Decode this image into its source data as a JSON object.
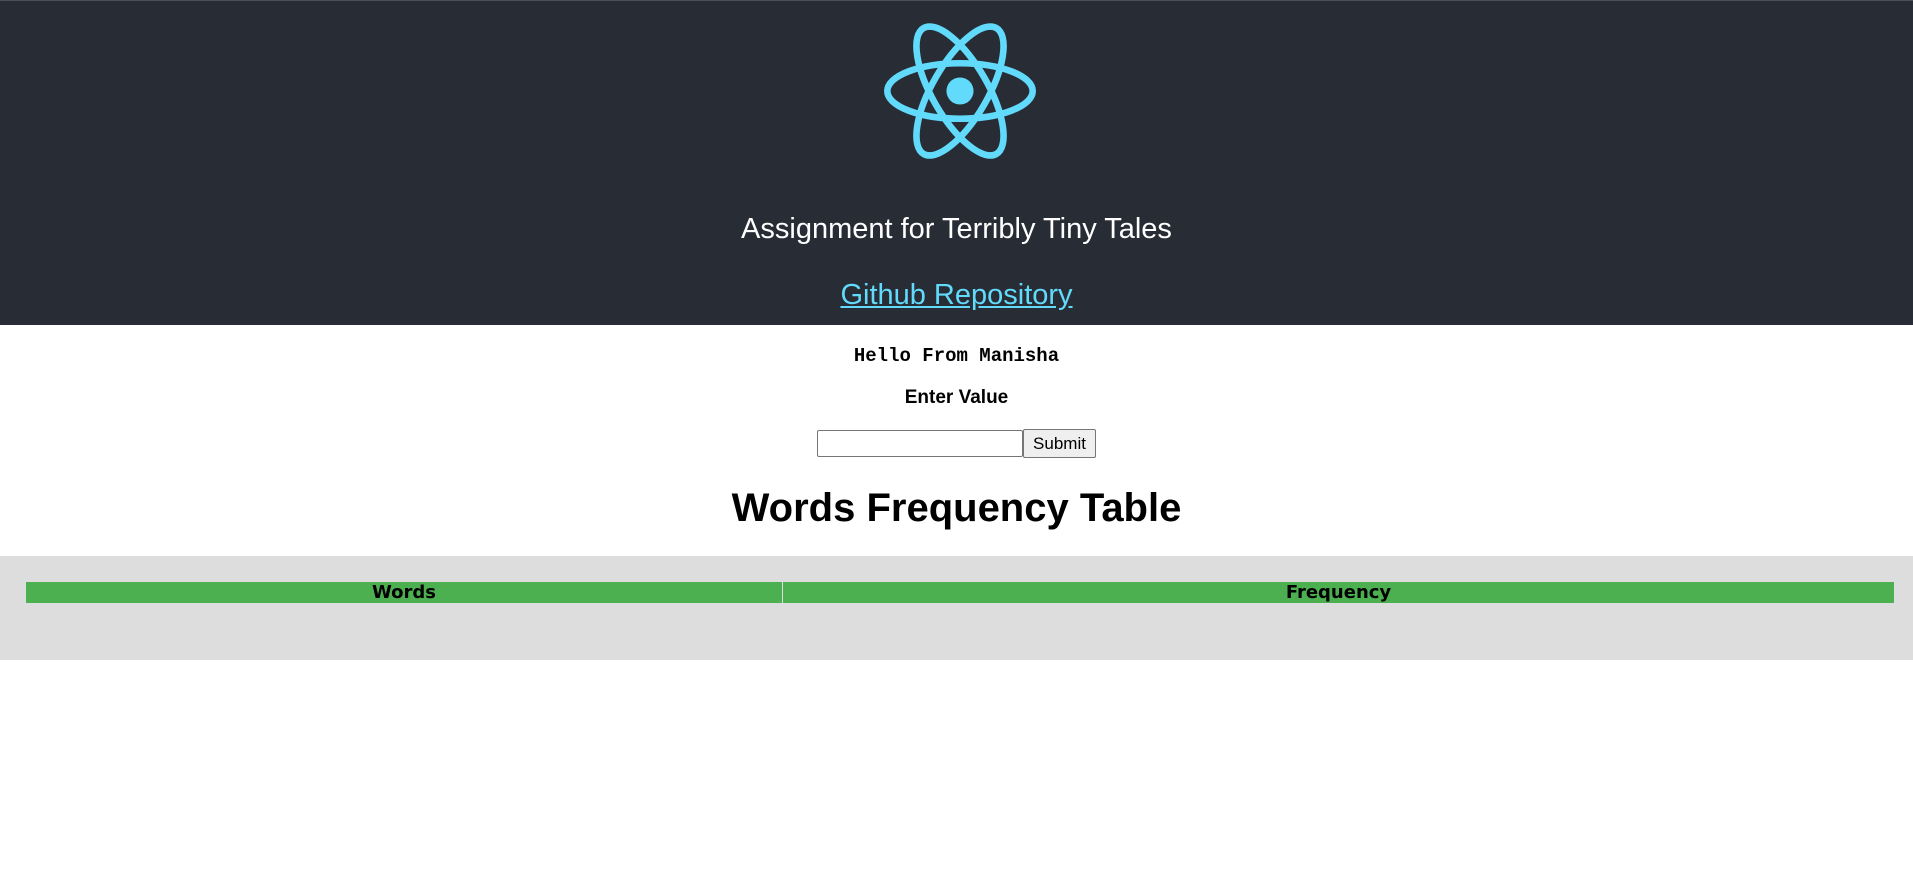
{
  "header": {
    "logo_icon": "react-atom-icon",
    "logo_color": "#61dafb",
    "background": "#282c34",
    "title": "Assignment for Terribly Tiny Tales",
    "repo_link": "Github Repository"
  },
  "main": {
    "greeting": "Hello From Manisha",
    "input_label": "Enter Value",
    "input_value": "",
    "submit_label": "Submit",
    "table_title": "Words Frequency Table"
  },
  "table": {
    "header_color": "#4caf50",
    "columns": [
      "Words",
      "Frequency"
    ],
    "rows": []
  }
}
